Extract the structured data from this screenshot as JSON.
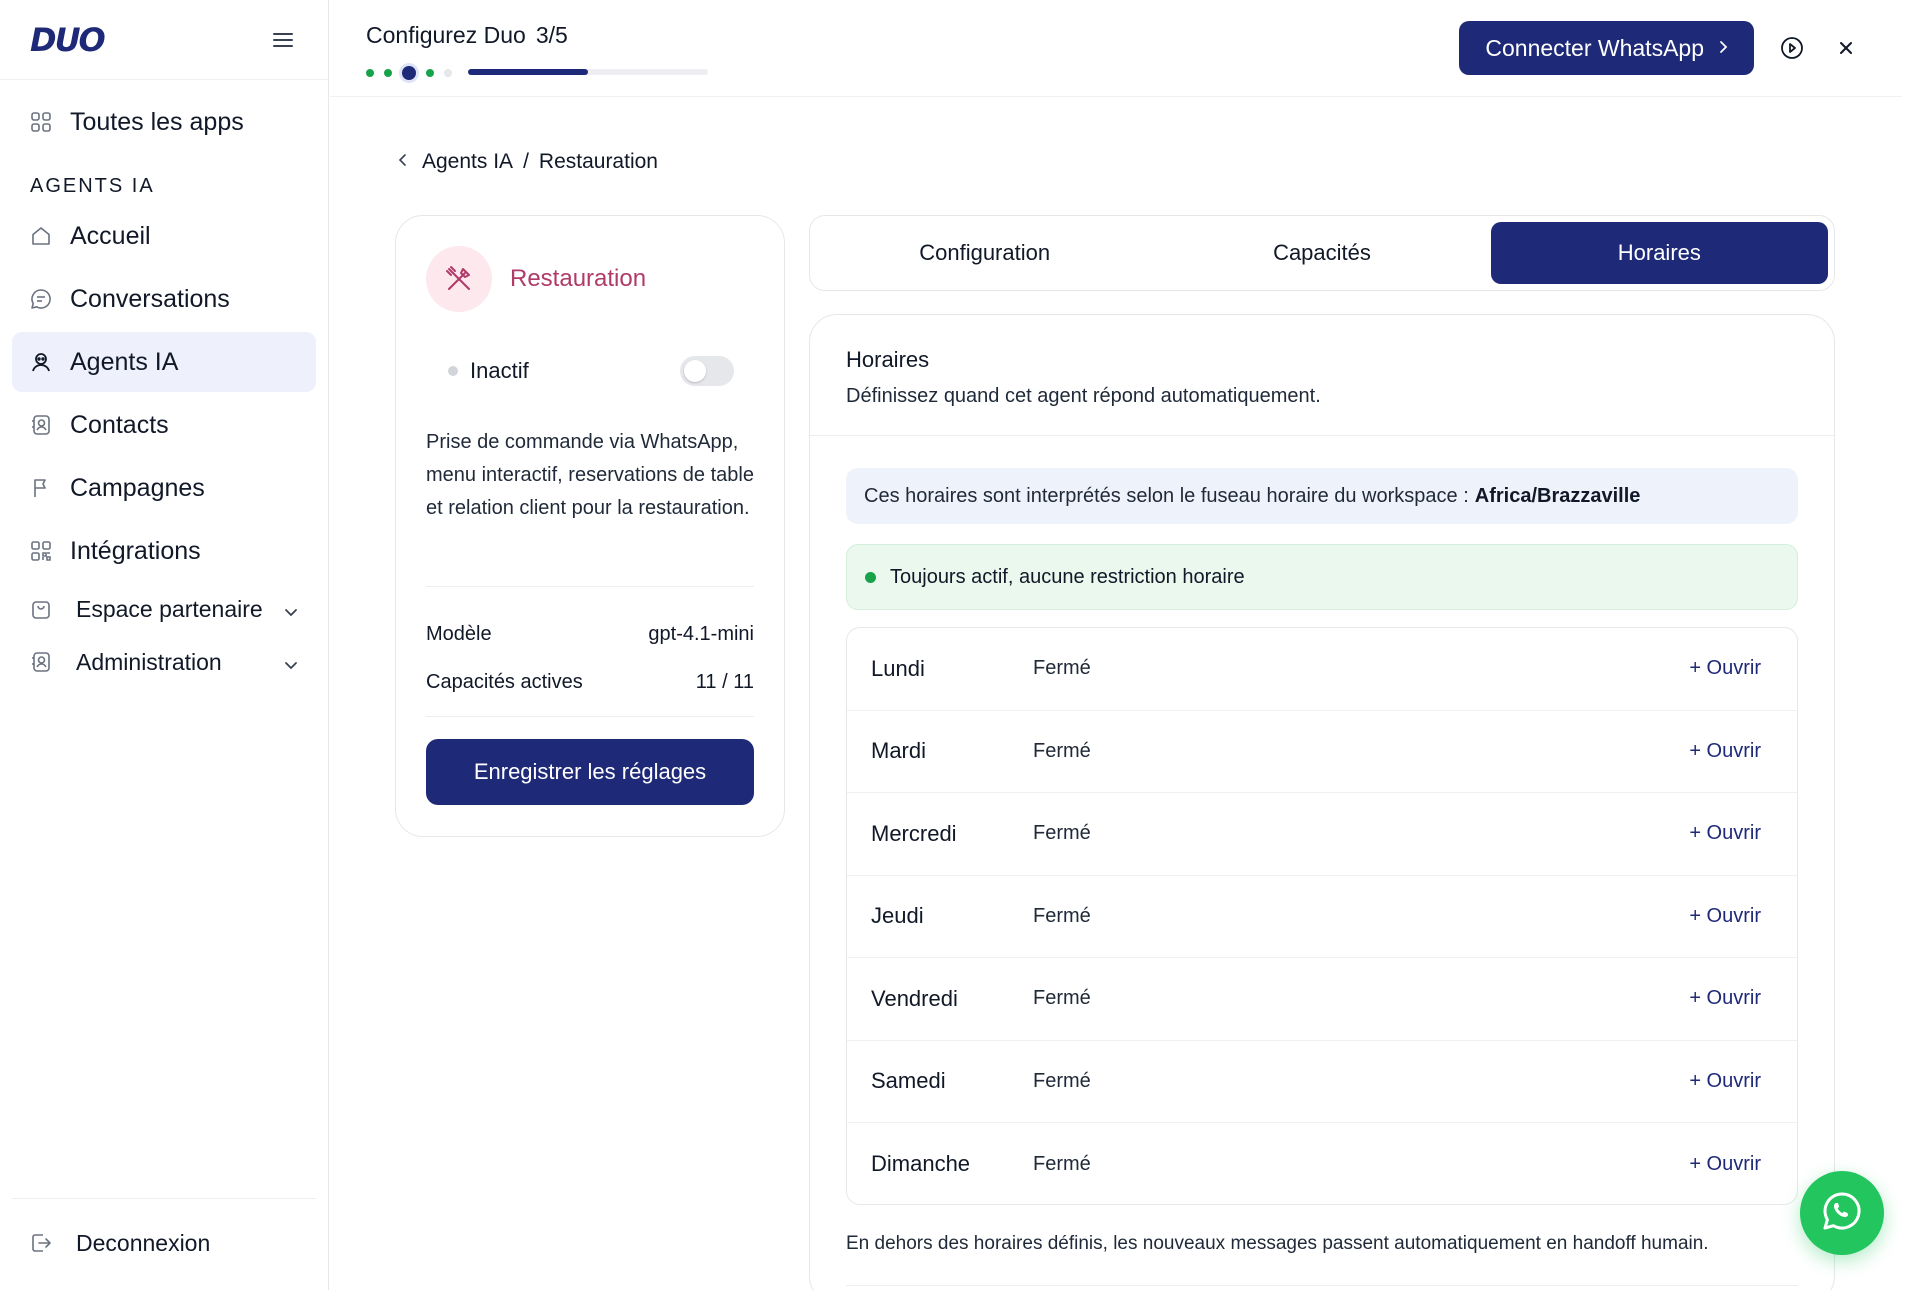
{
  "brand": {
    "logo_text": "DUO",
    "accent": "#1e2a78",
    "success": "#16a34a"
  },
  "sidebar": {
    "all_apps": "Toutes les apps",
    "section_title": "AGENTS IA",
    "items": [
      {
        "label": "Accueil",
        "icon": "home-icon"
      },
      {
        "label": "Conversations",
        "icon": "chat-icon"
      },
      {
        "label": "Agents IA",
        "icon": "bot-icon",
        "active": true
      },
      {
        "label": "Contacts",
        "icon": "contacts-icon"
      },
      {
        "label": "Campagnes",
        "icon": "flag-icon"
      },
      {
        "label": "Intégrations",
        "icon": "grid-icon"
      }
    ],
    "groups": [
      {
        "label": "Espace partenaire",
        "icon": "bag-icon"
      },
      {
        "label": "Administration",
        "icon": "admin-icon"
      }
    ],
    "logout": "Deconnexion"
  },
  "topbar": {
    "title": "Configurez Duo",
    "step": "3/5",
    "progress": 0.5,
    "cta_label": "Connecter WhatsApp"
  },
  "breadcrumb": {
    "parent": "Agents IA",
    "separator": "/",
    "current": "Restauration"
  },
  "agent": {
    "name": "Restauration",
    "status": "Inactif",
    "description": "Prise de commande via WhatsApp, menu interactif, reservations de table et relation client pour la restauration.",
    "model_label": "Modèle",
    "model_value": "gpt-4.1-mini",
    "caps_label": "Capacités actives",
    "caps_value": "11 / 11",
    "save_label": "Enregistrer les réglages"
  },
  "tabs": [
    {
      "label": "Configuration"
    },
    {
      "label": "Capacités"
    },
    {
      "label": "Horaires",
      "active": true
    }
  ],
  "schedule": {
    "title": "Horaires",
    "subtitle": "Définissez quand cet agent répond automatiquement.",
    "timezone_text": "Ces horaires sont interprétés selon le fuseau horaire du workspace :",
    "timezone_value": "Africa/Brazzaville",
    "always_active": "Toujours actif, aucune restriction horaire",
    "days": [
      {
        "name": "Lundi",
        "status": "Fermé",
        "action": "+ Ouvrir"
      },
      {
        "name": "Mardi",
        "status": "Fermé",
        "action": "+ Ouvrir"
      },
      {
        "name": "Mercredi",
        "status": "Fermé",
        "action": "+ Ouvrir"
      },
      {
        "name": "Jeudi",
        "status": "Fermé",
        "action": "+ Ouvrir"
      },
      {
        "name": "Vendredi",
        "status": "Fermé",
        "action": "+ Ouvrir"
      },
      {
        "name": "Samedi",
        "status": "Fermé",
        "action": "+ Ouvrir"
      },
      {
        "name": "Dimanche",
        "status": "Fermé",
        "action": "+ Ouvrir"
      }
    ],
    "footnote": "En dehors des horaires définis, les nouveaux messages passent automatiquement en handoff humain."
  }
}
